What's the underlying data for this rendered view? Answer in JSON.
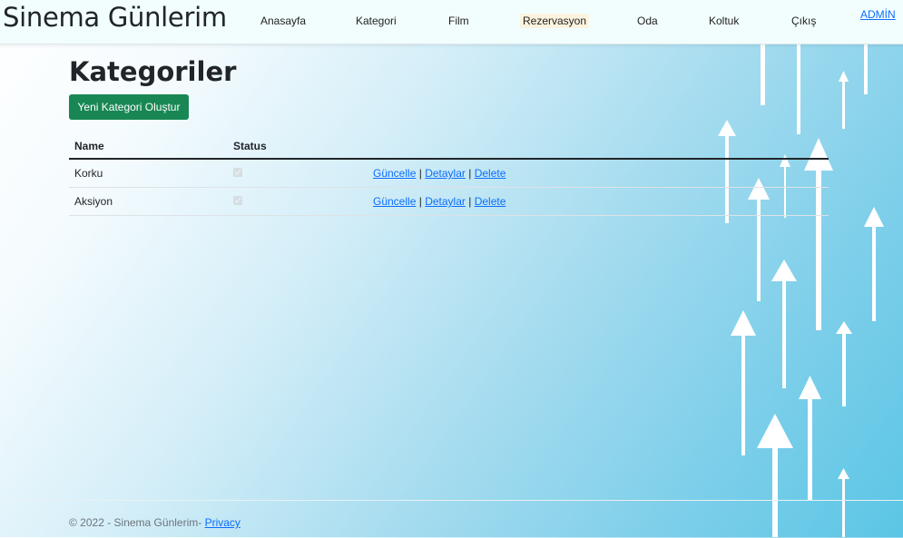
{
  "navbar": {
    "brand": "Sinema Günlerim",
    "items": [
      {
        "label": "Anasayfa"
      },
      {
        "label": "Kategori"
      },
      {
        "label": "Film"
      },
      {
        "label": "Rezervasyon"
      },
      {
        "label": "Oda"
      },
      {
        "label": "Koltuk"
      },
      {
        "label": "Çıkış"
      }
    ],
    "admin": "ADMİN"
  },
  "page": {
    "title": "Kategoriler",
    "create_button": "Yeni Kategori Oluştur"
  },
  "table": {
    "headers": {
      "name": "Name",
      "status": "Status"
    },
    "rows": [
      {
        "name": "Korku",
        "status": true,
        "edit": "Güncelle",
        "details": "Detaylar",
        "delete": "Delete"
      },
      {
        "name": "Aksiyon",
        "status": true,
        "edit": "Güncelle",
        "details": "Detaylar",
        "delete": "Delete"
      }
    ],
    "separator": "|"
  },
  "footer": {
    "text": "© 2022 - Sinema Günlerim-",
    "privacy": "Privacy"
  },
  "colors": {
    "primary_button": "#198754",
    "link": "#0d6efd",
    "active_nav_bg": "#fcf3df"
  }
}
